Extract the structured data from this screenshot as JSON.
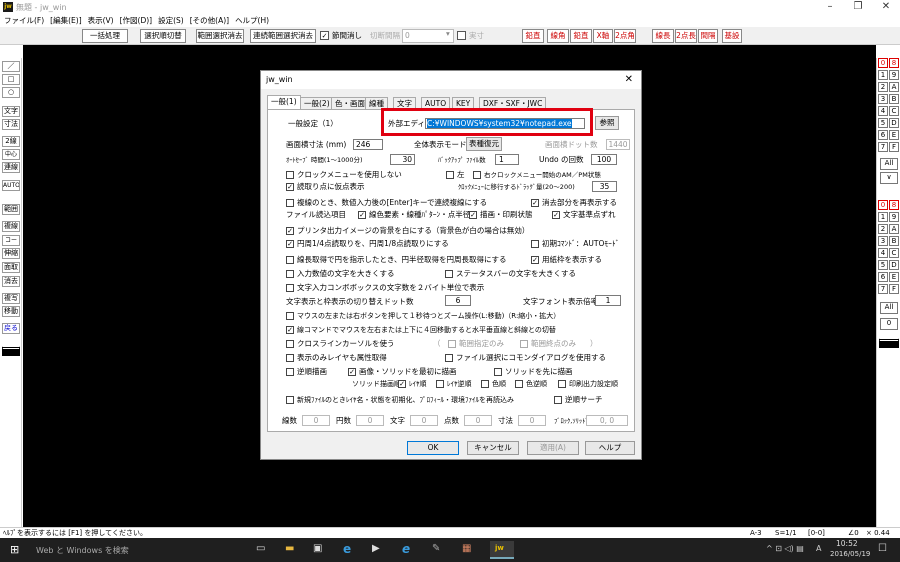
{
  "window": {
    "title": "無題 - jw_win",
    "app_icon": "jw"
  },
  "menu": [
    "ファイル(F)",
    "[編集(E)]",
    "表示(V)",
    "[作図(D)]",
    "設定(S)",
    "[その他(A)]",
    "ヘルプ(H)"
  ],
  "toolbar": {
    "buttons": [
      "一括処理",
      "選択順切替",
      "範囲選択消去",
      "連続範囲選択消去"
    ],
    "checkbox_label": "節間消し",
    "checkbox_checked": true,
    "combo_label": "切断間隔",
    "combo_value": "0",
    "real_label": "実寸",
    "right_buttons": [
      "鉛直",
      "線角",
      "鉛直",
      "X軸",
      "2点角",
      "線長",
      "2点長",
      "間隔",
      "基設"
    ]
  },
  "left_tools": [
    "／",
    "□",
    "○",
    "文字",
    "寸法",
    "2線",
    "中心線",
    "連線",
    "AUTO",
    "範囲",
    "複線",
    "コーナー",
    "伸縮",
    "面取",
    "消去",
    "複写",
    "移動",
    "戻る"
  ],
  "right_tools": [
    "0",
    "8",
    "1",
    "9",
    "2",
    "A",
    "3",
    "B",
    "4",
    "C",
    "5",
    "D",
    "6",
    "E",
    "7",
    "F",
    "All",
    "∨",
    "0",
    "8",
    "1",
    "9",
    "2",
    "A",
    "3",
    "B",
    "4",
    "C",
    "5",
    "D",
    "6",
    "E",
    "7",
    "F",
    "All",
    "0"
  ],
  "dialog": {
    "title": "jw_win",
    "tabs": [
      "一般(1)",
      "一般(2)",
      "色・画面",
      "線種",
      "文字",
      "AUTO",
      "KEY",
      "DXF・SXF・JWC"
    ],
    "section": "一般設定（1）",
    "ext_editor_label": "外部エディタ",
    "ext_editor_value": "C:¥WINDOWS¥system32¥notepad.exe",
    "browse": "参照",
    "screen_size_label": "画面横寸法 (mm)",
    "screen_size": "246",
    "fullscreen_label": "全体表示モード",
    "fullscreen_btn": "表種復元",
    "dot_label": "画面横ドット数",
    "dot_value": "1440",
    "autosave_label": "ｵｰﾄｾｰﾌﾞ 時間(1～1000分)",
    "autosave": "30",
    "backup_label": "ﾊﾞｯｸｱｯﾌﾟ ﾌｧｲﾙ数",
    "backup": "1",
    "undo_label": "Undo の回数",
    "undo": "100",
    "rows": [
      {
        "text": "クロックメニューを使用しない",
        "checked": false
      },
      {
        "text": "読取り点に仮点表示",
        "checked": true
      },
      {
        "text": "複線のとき、数値入力後の[Enter]キーで連続複線にする",
        "checked": false
      },
      {
        "text": "プリンタ出力イメージの背景を白にする（背景色が白の場合は無効）",
        "checked": true
      },
      {
        "text": "円周1/4点読取りを、円周1/8点読取りにする",
        "checked": true
      },
      {
        "text": "線長取得で円を指示したとき、円半径取得を円周長取得にする",
        "checked": false
      },
      {
        "text": "入力数値の文字を大きくする",
        "checked": false
      },
      {
        "text": "文字入力コンボボックスの文字数を２バイト単位で表示",
        "checked": false
      },
      {
        "text": "マウスの左または右ボタンを押して１秒待つとズーム操作(L:移動)（R:縮小・拡大）",
        "checked": false
      },
      {
        "text": "線コマンドでマウスを左右または上下に４回移動すると水平垂直線と斜線との切替",
        "checked": true
      },
      {
        "text": "クロスラインカーソルを使う",
        "checked": false
      },
      {
        "text": "表示のみレイヤも属性取得",
        "checked": false
      },
      {
        "text": "逆順描画",
        "checked": false
      },
      {
        "text": "新規ﾌｧｲﾙのときﾚｲﾔ名・状態を初期化、ﾌﾟﾛﾌｨｰﾙ・環境ﾌｧｲﾙを再読込み",
        "checked": false
      }
    ],
    "left_label": "左",
    "right_clock": "右クロックメニュー開始のAM／PM状態",
    "clock_drag_label": "ｸﾛｯｸﾒﾆｭｰに移行するﾄﾞﾗｯｸﾞ量(20～200)",
    "clock_drag": "35",
    "erase_redisplay": "消去部分を再表示する",
    "file_read_label": "ファイル読込項目",
    "read_color": "線色要素・線種ﾊﾟﾀｰﾝ・点半径",
    "read_draw": "描画・印刷状態",
    "read_text": "文字基準点ずれ",
    "init_cmd": "初期ｺﾏﾝﾄﾞ：AUTOﾓｰﾄﾞ",
    "paper_frame": "用紙枠を表示する",
    "statusbar_text": "ステータスバーの文字を大きくする",
    "text_switch_label": "文字表示と枠表示の切り替えドット数",
    "text_switch": "6",
    "font_ratio_label": "文字フォント表示倍率",
    "font_ratio": "1",
    "range_only": "範囲指定のみ",
    "range_end": "範囲終点のみ",
    "file_select": "ファイル選択にコモンダイアログを使用する",
    "image_first": "画像・ソリッドを最初に描画",
    "solid_first": "ソリッドを先に描画",
    "solid_order_label": "ソリッド描画順",
    "layer_order": "ﾚｲﾔ順",
    "layer_rev": "ﾚｲﾔ逆順",
    "color_order": "色順",
    "color_rev": "色逆順",
    "print_order": "印刷出力設定順",
    "reverse_search": "逆順サーチ",
    "counts": [
      {
        "label": "線数",
        "value": "0"
      },
      {
        "label": "円数",
        "value": "0"
      },
      {
        "label": "文字",
        "value": "0"
      },
      {
        "label": "点数",
        "value": "0"
      },
      {
        "label": "寸法",
        "value": "0"
      },
      {
        "label": "ﾌﾞﾛｯｸ,ｿﾘｯﾄﾞ",
        "value": "0, 0"
      }
    ],
    "ok": "OK",
    "cancel": "キャンセル",
    "apply": "適用(A)",
    "help": "ヘルプ"
  },
  "status": {
    "left": "ﾍﾙﾌﾟを表示するには [F1] を押してください。",
    "a3": "A-3",
    "scale": "S=1/1",
    "layer": "[0-0]",
    "angle": "∠0",
    "zoom": "× 0.44"
  },
  "taskbar": {
    "search": "Web と Windows を検索",
    "time": "10:52",
    "date": "2016/05/19",
    "ime": "A"
  },
  "colors": {
    "canvas": "#000000",
    "highlight": "#e00010",
    "toolbar_red": "#cc0000"
  }
}
